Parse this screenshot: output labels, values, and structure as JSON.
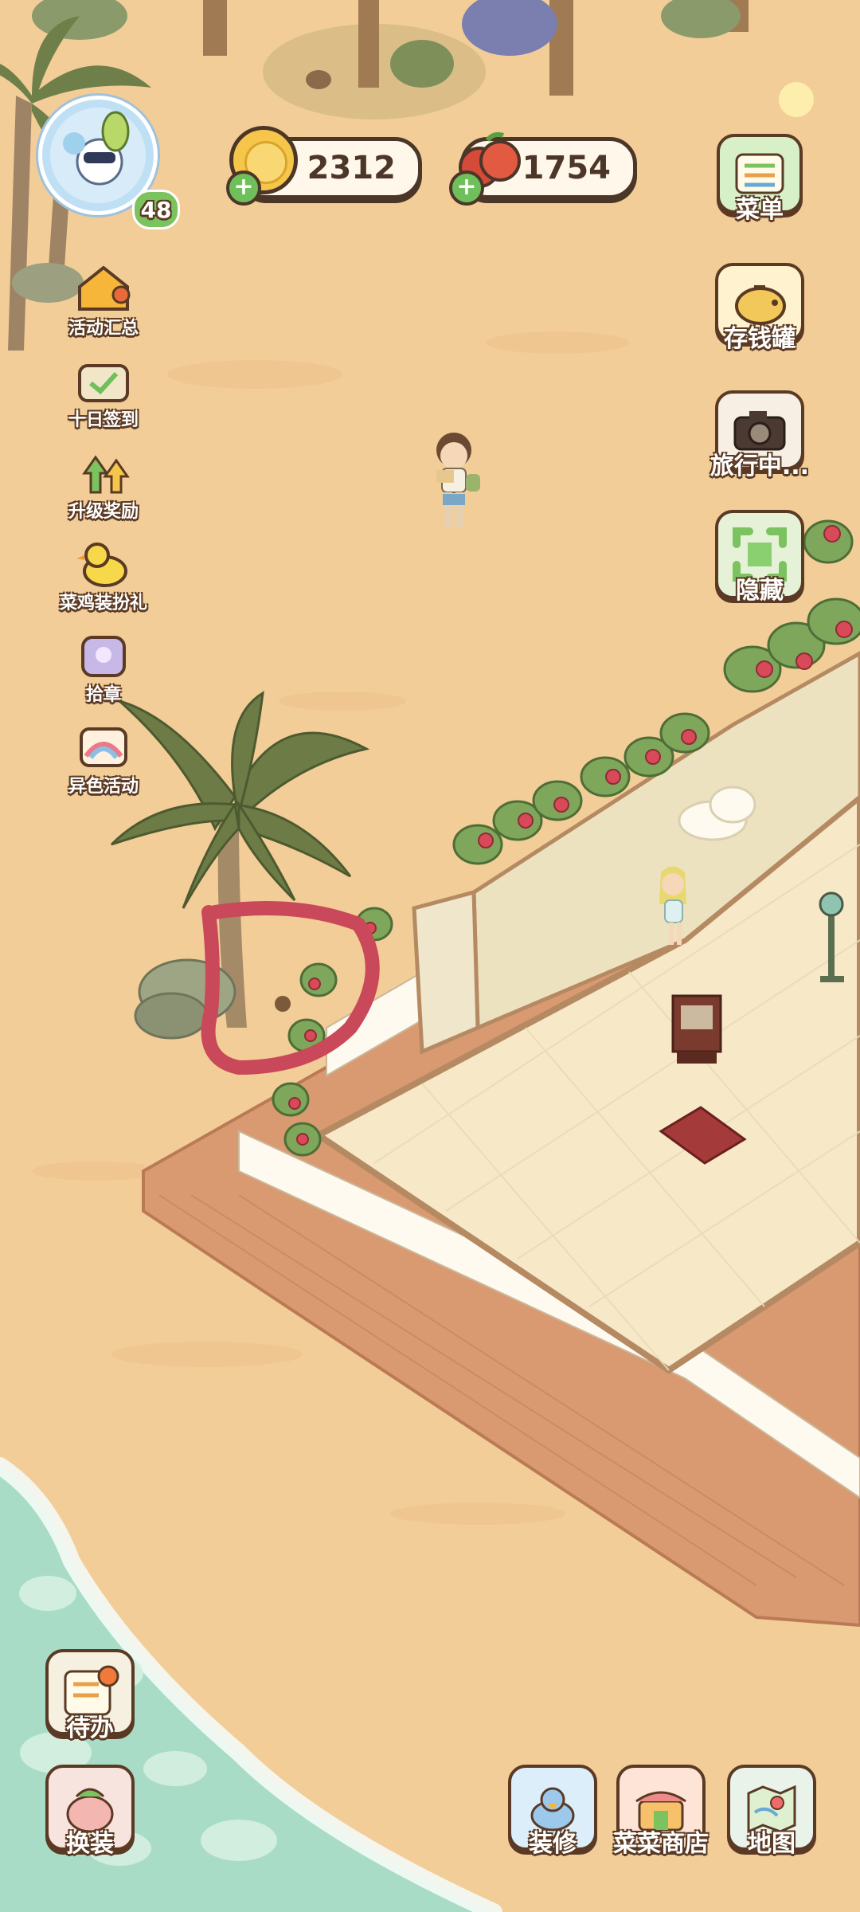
{
  "player": {
    "level": "48"
  },
  "currency": {
    "coins": "2312",
    "food": "1754"
  },
  "left_menu": [
    {
      "label": "活动汇总",
      "icon": "house-event-icon"
    },
    {
      "label": "十日签到",
      "icon": "checkin-basket-icon"
    },
    {
      "label": "升级奖励",
      "icon": "level-up-arrows-icon"
    },
    {
      "label": "菜鸡装扮礼",
      "icon": "yellow-duck-icon"
    },
    {
      "label": "拾章",
      "icon": "stamp-bag-icon"
    },
    {
      "label": "异色活动",
      "icon": "rainbow-card-icon"
    }
  ],
  "right_menu": [
    {
      "label": "菜单",
      "icon": "menu-list-icon"
    },
    {
      "label": "存钱罐",
      "icon": "piggy-bank-icon"
    },
    {
      "label": "旅行中...",
      "icon": "camera-icon"
    },
    {
      "label": "隐藏",
      "icon": "hide-frame-icon"
    }
  ],
  "bottom_left": [
    {
      "label": "待办",
      "icon": "todo-list-icon"
    },
    {
      "label": "换装",
      "icon": "dress-up-radish-icon"
    }
  ],
  "bottom_right": [
    {
      "label": "装修",
      "icon": "decorate-duck-icon"
    },
    {
      "label": "菜菜商店",
      "icon": "shop-icon"
    },
    {
      "label": "地图",
      "icon": "map-icon"
    }
  ],
  "colors": {
    "sand": "#f2cd98",
    "floor": "#f7e8c8",
    "deck": "#d99a72",
    "sea": "#a9dcc6",
    "annotation": "#c9485a"
  }
}
